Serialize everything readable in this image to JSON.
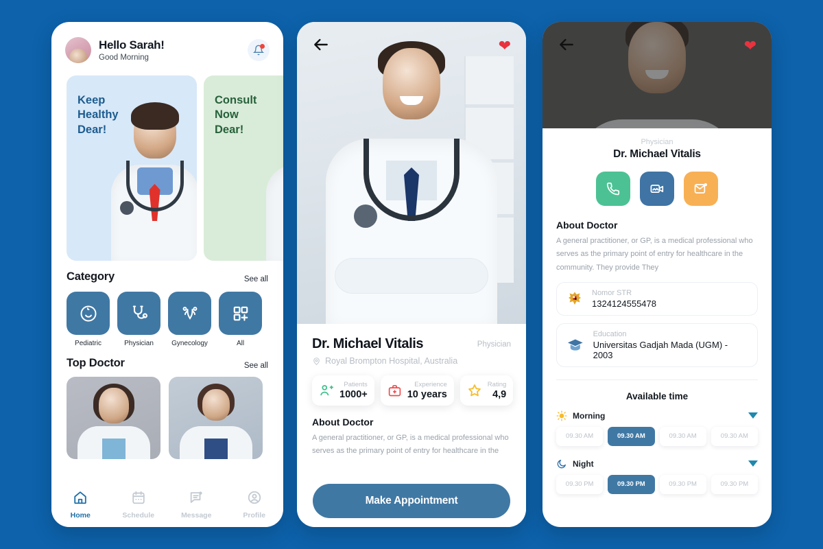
{
  "theme": {
    "background": "#0d62ab",
    "primary": "#4078a4",
    "accent_red": "#e8333f"
  },
  "phone1": {
    "header": {
      "greeting_name": "Hello Sarah!",
      "greeting_sub": "Good Morning",
      "avatar": "user-avatar",
      "bell": "notification-bell-icon"
    },
    "promos": [
      {
        "text": "Keep\nHealthy\nDear!",
        "bg": "#d7e8f8",
        "color": "#1d5c8f"
      },
      {
        "text": "Consult\nNow\nDear!",
        "bg": "#d9ecd9",
        "color": "#27613a"
      }
    ],
    "category": {
      "title": "Category",
      "see_all": "See all",
      "items": [
        {
          "label": "Pediatric",
          "icon": "baby-face-icon"
        },
        {
          "label": "Physician",
          "icon": "stethoscope-icon"
        },
        {
          "label": "Gynecology",
          "icon": "uterus-icon"
        },
        {
          "label": "All",
          "icon": "grid-plus-icon"
        }
      ]
    },
    "top_doctor": {
      "title": "Top Doctor",
      "see_all": "See all"
    },
    "tabs": [
      {
        "label": "Home",
        "icon": "home-icon",
        "active": true
      },
      {
        "label": "Schedule",
        "icon": "calendar-icon",
        "active": false
      },
      {
        "label": "Message",
        "icon": "message-icon",
        "active": false
      },
      {
        "label": "Profile",
        "icon": "profile-icon",
        "active": false
      }
    ]
  },
  "phone2": {
    "nav": {
      "back": "back-arrow-icon",
      "favorite": "heart-icon"
    },
    "doctor": {
      "name": "Dr. Michael Vitalis",
      "role": "Physician",
      "location": "Royal Brompton Hospital, Australia"
    },
    "stats": [
      {
        "label": "Patients",
        "value": "1000+",
        "icon": "patients-icon",
        "color": "#3cc08a"
      },
      {
        "label": "Experience",
        "value": "10 years",
        "icon": "briefcase-medical-icon",
        "color": "#ef4a4a"
      },
      {
        "label": "Rating",
        "value": "4,9",
        "icon": "star-icon",
        "color": "#f6bd2b"
      }
    ],
    "about": {
      "title": "About Doctor",
      "text": "A general practitioner, or GP, is a medical professional who serves as the primary point of entry for healthcare in the"
    },
    "cta": "Make Appointment"
  },
  "phone3": {
    "nav": {
      "back": "back-arrow-icon",
      "favorite": "heart-icon"
    },
    "doctor": {
      "role": "Physician",
      "name": "Dr. Michael Vitalis"
    },
    "actions": [
      {
        "name": "call",
        "icon": "phone-icon",
        "color": "#4cc294"
      },
      {
        "name": "video",
        "icon": "video-camera-icon",
        "color": "#3f74a4"
      },
      {
        "name": "message",
        "icon": "envelope-icon",
        "color": "#f8b055"
      }
    ],
    "about": {
      "title": "About Doctor",
      "text": "A general practitioner, or GP, is a medical professional who serves as the primary point of entry for healthcare in the community. They provide They"
    },
    "info_cards": [
      {
        "label": "Nomor STR",
        "value": "1324124555478",
        "icon": "garuda-emblem-icon"
      },
      {
        "label": "Education",
        "value": "Universitas Gadjah Mada (UGM) - 2003",
        "icon": "graduation-cap-icon"
      }
    ],
    "available": {
      "title": "Available time",
      "groups": [
        {
          "label": "Morning",
          "icon": "sun-icon",
          "caret": "chevron-down-icon",
          "slots": [
            {
              "time": "09.30 AM",
              "selected": false
            },
            {
              "time": "09.30 AM",
              "selected": true
            },
            {
              "time": "09.30 AM",
              "selected": false
            },
            {
              "time": "09.30 AM",
              "selected": false
            }
          ]
        },
        {
          "label": "Night",
          "icon": "moon-icon",
          "caret": "chevron-down-icon",
          "slots": [
            {
              "time": "09.30 PM",
              "selected": false
            },
            {
              "time": "09.30 PM",
              "selected": true
            },
            {
              "time": "09.30 PM",
              "selected": false
            },
            {
              "time": "09.30 PM",
              "selected": false
            }
          ]
        }
      ]
    }
  }
}
